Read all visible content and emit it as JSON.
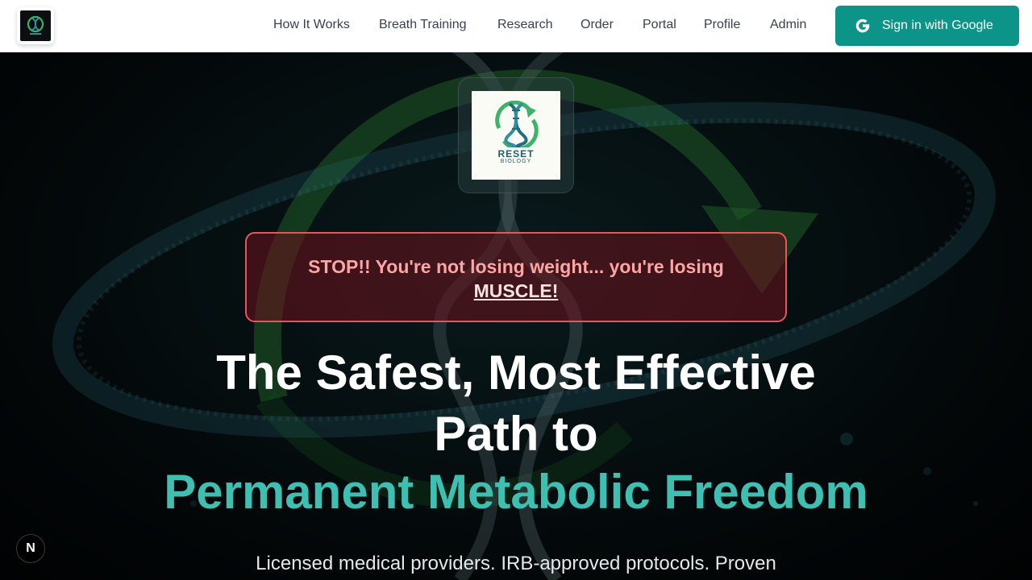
{
  "header": {
    "logo_icon": "reset-biology-logo",
    "nav": [
      {
        "label": "How It Works"
      },
      {
        "label": "Breath Training"
      },
      {
        "label": "Research"
      },
      {
        "label": "Order"
      },
      {
        "label": "Portal"
      },
      {
        "label": "Profile"
      },
      {
        "label": "Admin"
      }
    ],
    "signin_label": "Sign in with Google",
    "signin_icon": "google-icon",
    "brand_color": "#0d9488"
  },
  "hero": {
    "logo_text_top": "RESET",
    "logo_text_bottom": "BIOLOGY",
    "alert_text": "STOP!! You're not losing weight... you're losing",
    "alert_emphasis": "MUSCLE!",
    "headline_line1": "The Safest, Most Effective",
    "headline_line2": "Path to",
    "headline_accent": "Permanent Metabolic Freedom",
    "subheadline": "Licensed medical providers. IRB-approved protocols. Proven",
    "accent_color": "#3fbfb2",
    "alert_color": "#e8555b"
  },
  "dev_badge": {
    "label": "N",
    "icon": "nextjs-dev-indicator-icon"
  }
}
